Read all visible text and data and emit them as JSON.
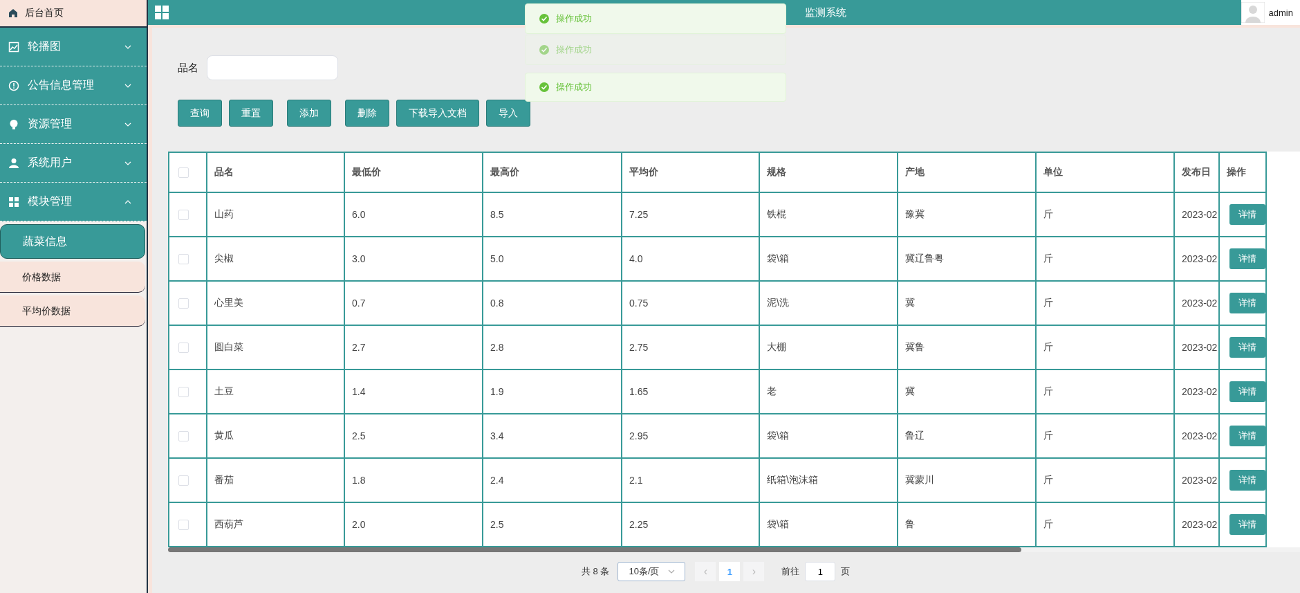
{
  "header": {
    "title": "监测系统",
    "user": "admin"
  },
  "sidebar": {
    "home": "后台首页",
    "menus": [
      {
        "label": "轮播图",
        "expanded": false
      },
      {
        "label": "公告信息管理",
        "expanded": false
      },
      {
        "label": "资源管理",
        "expanded": false
      },
      {
        "label": "系统用户",
        "expanded": false
      },
      {
        "label": "模块管理",
        "expanded": true,
        "children": [
          {
            "label": "蔬菜信息",
            "selected": true
          },
          {
            "label": "价格数据",
            "selected": false
          },
          {
            "label": "平均价数据",
            "selected": false
          }
        ]
      }
    ]
  },
  "toasts": [
    {
      "text": "操作成功",
      "faded": false
    },
    {
      "text": "操作成功",
      "faded": true
    },
    {
      "text": "操作成功",
      "faded": false
    }
  ],
  "search": {
    "label": "品名"
  },
  "buttons": [
    "查询",
    "重置",
    "添加",
    "删除",
    "下载导入文档",
    "导入"
  ],
  "table": {
    "all_checked": false,
    "columns": [
      "品名",
      "最低价",
      "最高价",
      "平均价",
      "规格",
      "产地",
      "单位",
      "发布日"
    ],
    "action_column": "操作",
    "rows": [
      {
        "checked": false,
        "cells": [
          "山药",
          "6.0",
          "8.5",
          "7.25",
          "铁棍",
          "豫冀",
          "斤",
          "2023-02"
        ],
        "action": "详情"
      },
      {
        "checked": false,
        "cells": [
          "尖椒",
          "3.0",
          "5.0",
          "4.0",
          "袋\\箱",
          "冀辽鲁粤",
          "斤",
          "2023-02"
        ],
        "action": "详情"
      },
      {
        "checked": false,
        "cells": [
          "心里美",
          "0.7",
          "0.8",
          "0.75",
          "泥\\洗",
          "冀",
          "斤",
          "2023-02"
        ],
        "action": "详情"
      },
      {
        "checked": false,
        "cells": [
          "圆白菜",
          "2.7",
          "2.8",
          "2.75",
          "大棚",
          "冀鲁",
          "斤",
          "2023-02"
        ],
        "action": "详情"
      },
      {
        "checked": false,
        "cells": [
          "土豆",
          "1.4",
          "1.9",
          "1.65",
          "老",
          "冀",
          "斤",
          "2023-02"
        ],
        "action": "详情"
      },
      {
        "checked": false,
        "cells": [
          "黄瓜",
          "2.5",
          "3.4",
          "2.95",
          "袋\\箱",
          "鲁辽",
          "斤",
          "2023-02"
        ],
        "action": "详情"
      },
      {
        "checked": false,
        "cells": [
          "番茄",
          "1.8",
          "2.4",
          "2.1",
          "纸箱\\泡沫箱",
          "冀蒙川",
          "斤",
          "2023-02"
        ],
        "action": "详情"
      },
      {
        "checked": false,
        "cells": [
          "西葫芦",
          "2.0",
          "2.5",
          "2.25",
          "袋\\箱",
          "鲁",
          "斤",
          "2023-02"
        ],
        "action": "详情"
      }
    ]
  },
  "pagination": {
    "total": "共 8 条",
    "page_size": "10条/页",
    "prev": "‹",
    "pages": [
      {
        "label": "1",
        "selected": true
      }
    ],
    "next": "›",
    "goto_label": "前往",
    "goto_value": "1",
    "goto_suffix": "页"
  }
}
